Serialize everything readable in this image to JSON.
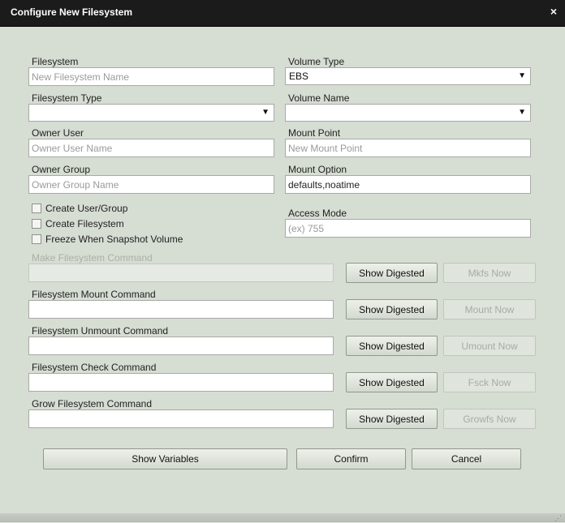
{
  "window": {
    "title": "Configure New Filesystem",
    "close_glyph": "×"
  },
  "fields": {
    "filesystem": {
      "label": "Filesystem",
      "placeholder": "New Filesystem Name",
      "value": ""
    },
    "volume_type": {
      "label": "Volume Type",
      "value": "EBS"
    },
    "filesystem_type": {
      "label": "Filesystem Type",
      "value": ""
    },
    "volume_name": {
      "label": "Volume Name",
      "value": ""
    },
    "owner_user": {
      "label": "Owner User",
      "placeholder": "Owner User Name",
      "value": ""
    },
    "mount_point": {
      "label": "Mount Point",
      "placeholder": "New Mount Point",
      "value": ""
    },
    "owner_group": {
      "label": "Owner Group",
      "placeholder": "Owner Group Name",
      "value": ""
    },
    "mount_option": {
      "label": "Mount Option",
      "value": "defaults,noatime"
    },
    "access_mode": {
      "label": "Access Mode",
      "placeholder": "(ex) 755",
      "value": ""
    }
  },
  "checkboxes": [
    {
      "label": "Create User/Group",
      "checked": false
    },
    {
      "label": "Create Filesystem",
      "checked": false
    },
    {
      "label": "Freeze When Snapshot Volume",
      "checked": false
    }
  ],
  "commands": [
    {
      "label": "Make Filesystem Command",
      "disabled": true,
      "digest_label": "Show Digested",
      "action_label": "Mkfs Now"
    },
    {
      "label": "Filesystem Mount Command",
      "disabled": false,
      "digest_label": "Show Digested",
      "action_label": "Mount Now"
    },
    {
      "label": "Filesystem Unmount Command",
      "disabled": false,
      "digest_label": "Show Digested",
      "action_label": "Umount Now"
    },
    {
      "label": "Filesystem Check Command",
      "disabled": false,
      "digest_label": "Show Digested",
      "action_label": "Fsck Now"
    },
    {
      "label": "Grow Filesystem Command",
      "disabled": false,
      "digest_label": "Show Digested",
      "action_label": "Growfs Now"
    }
  ],
  "footer": {
    "show_variables": "Show Variables",
    "confirm": "Confirm",
    "cancel": "Cancel"
  },
  "colors": {
    "titlebar": "#1b1b1b",
    "dialog_bg": "#d6ddd3"
  }
}
